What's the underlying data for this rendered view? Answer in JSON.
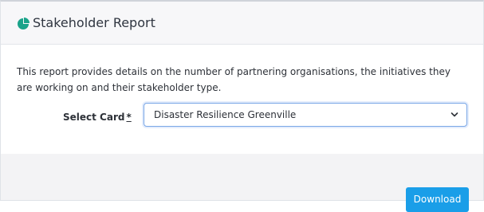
{
  "header": {
    "title": "Stakeholder Report",
    "icon": "pie-chart-icon",
    "icon_color": "#1aa38a"
  },
  "body": {
    "description": "This report provides details on the number of partnering organisations, the initiatives they are working on and their stakeholder type.",
    "select_card": {
      "label": "Select Card",
      "required_marker": "*",
      "selected_value": "Disaster Resilience Greenville",
      "chevron_icon": "chevron-down-icon"
    }
  },
  "footer": {
    "download_label": "Download",
    "button_color": "#1a9ee8"
  }
}
